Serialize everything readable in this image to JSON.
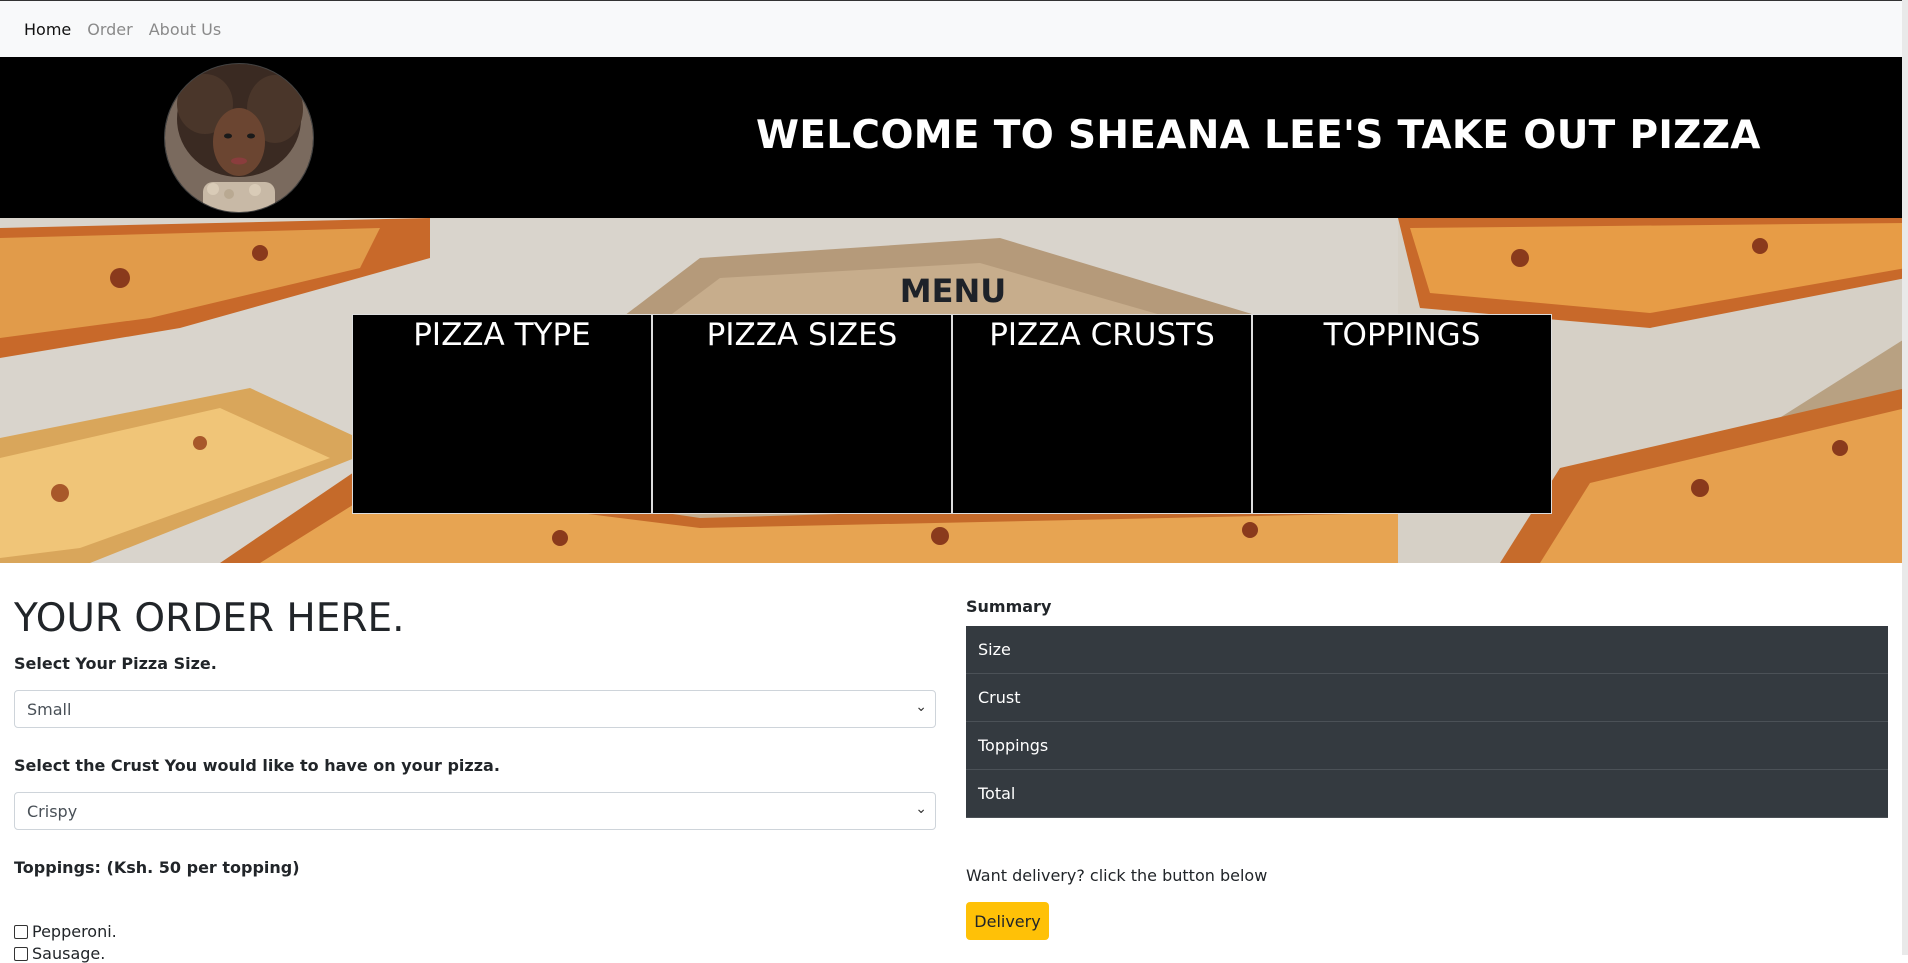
{
  "nav": {
    "items": [
      {
        "label": "Home",
        "active": true
      },
      {
        "label": "Order",
        "active": false
      },
      {
        "label": "About Us",
        "active": false
      }
    ]
  },
  "header": {
    "title": "WELCOME TO SHEANA LEE'S TAKE OUT PIZZA"
  },
  "menu": {
    "title": "MENU",
    "boxes": [
      "PIZZA TYPE",
      "PIZZA SIZES",
      "PIZZA CRUSTS",
      "TOPPINGS"
    ]
  },
  "order": {
    "heading": "YOUR ORDER HERE.",
    "size_label": "Select Your Pizza Size.",
    "size_value": "Small",
    "crust_label": "Select the Crust You would like to have on your pizza.",
    "crust_value": "Crispy",
    "toppings_label": "Toppings: (Ksh. 50 per topping)",
    "toppings": [
      "Pepperoni.",
      "Sausage."
    ]
  },
  "summary": {
    "title": "Summary",
    "items": [
      "Size",
      "Crust",
      "Toppings",
      "Total"
    ]
  },
  "delivery": {
    "prompt": "Want delivery? click the button below",
    "button_label": "Delivery"
  },
  "colors": {
    "header_bg": "#000000",
    "summary_bg": "#343a40",
    "delivery_btn": "#ffc107",
    "navbar_bg": "#f8f9fa"
  }
}
